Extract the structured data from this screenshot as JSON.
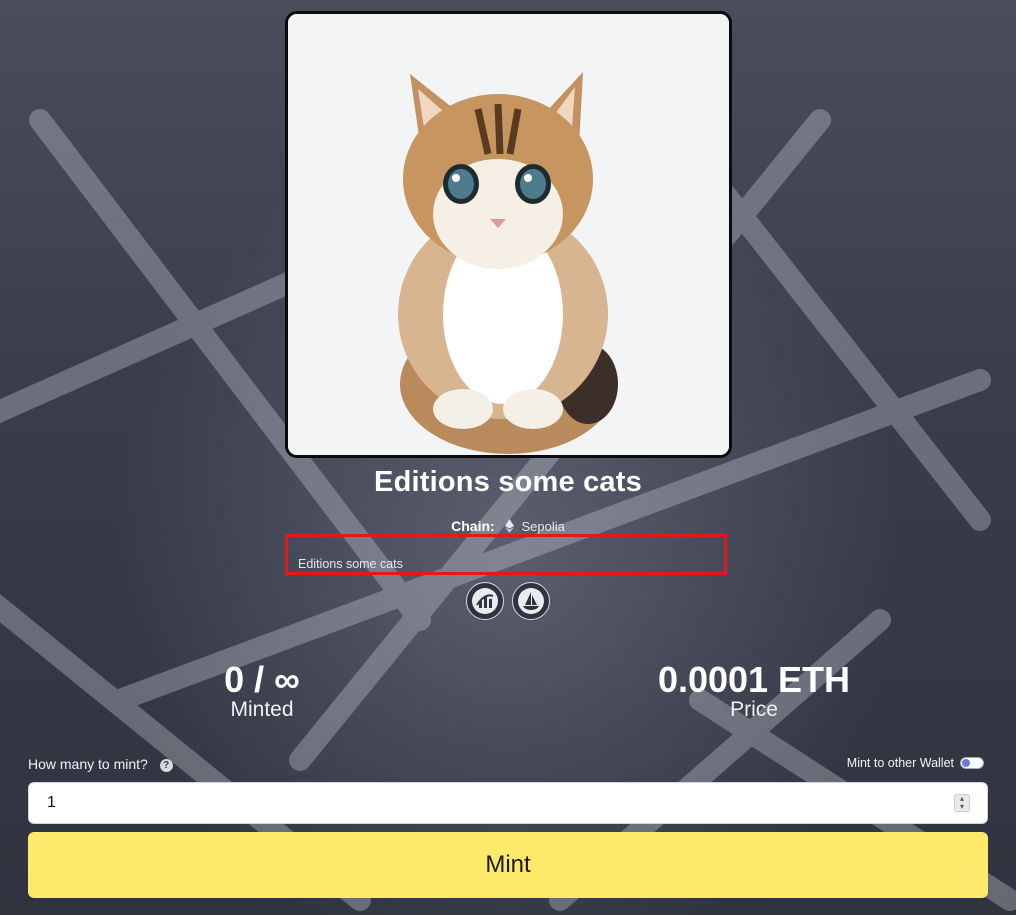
{
  "collection": {
    "title": "Editions some cats",
    "chain_label": "Chain:",
    "chain_name": "Sepolia",
    "description": "Editions some cats"
  },
  "links": [
    {
      "icon": "marketplace-chart-icon"
    },
    {
      "icon": "opensea-icon"
    }
  ],
  "stats": {
    "minted_value": "0 / ∞",
    "minted_label": "Minted",
    "price_value": "0.0001 ETH",
    "price_label": "Price"
  },
  "mint_form": {
    "quantity_label": "How many to mint?",
    "help_glyph": "?",
    "other_wallet_label": "Mint to other Wallet",
    "other_wallet_enabled": false,
    "quantity_value": "1",
    "mint_button_label": "Mint"
  },
  "colors": {
    "accent_button": "#fde96a",
    "highlight_border": "#e0191f",
    "background": "#3d414e"
  }
}
